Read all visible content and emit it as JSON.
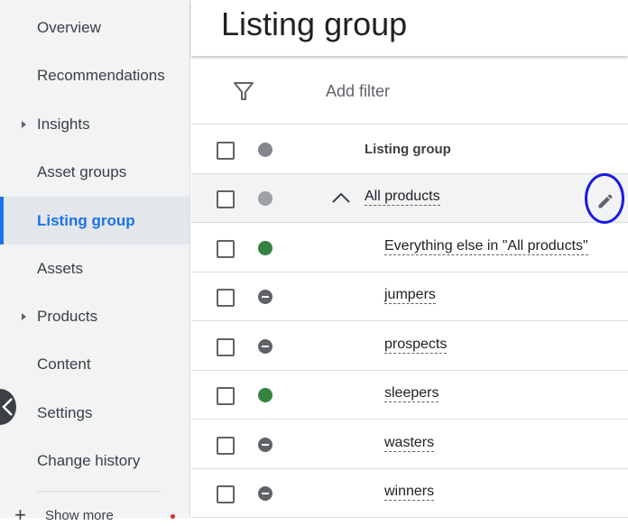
{
  "sidebar": {
    "items": [
      {
        "label": "Overview",
        "expandable": false
      },
      {
        "label": "Recommendations",
        "expandable": false
      },
      {
        "label": "Insights",
        "expandable": true
      },
      {
        "label": "Asset groups",
        "expandable": false
      },
      {
        "label": "Listing group",
        "expandable": false,
        "active": true
      },
      {
        "label": "Assets",
        "expandable": false
      },
      {
        "label": "Products",
        "expandable": true
      },
      {
        "label": "Content",
        "expandable": false
      },
      {
        "label": "Settings",
        "expandable": false
      },
      {
        "label": "Change history",
        "expandable": false
      }
    ],
    "show_more_label": "Show more"
  },
  "header": {
    "title": "Listing group"
  },
  "filter": {
    "add_filter_label": "Add filter"
  },
  "table": {
    "column_header": "Listing group",
    "root": {
      "label": "All products",
      "status": "gray"
    },
    "rows": [
      {
        "label": "Everything else in \"All products\"",
        "status": "included"
      },
      {
        "label": "jumpers",
        "status": "excluded"
      },
      {
        "label": "prospects",
        "status": "excluded"
      },
      {
        "label": "sleepers",
        "status": "included"
      },
      {
        "label": "wasters",
        "status": "excluded"
      },
      {
        "label": "winners",
        "status": "excluded"
      }
    ]
  },
  "colors": {
    "accent": "#1a73e8",
    "included": "#34843f",
    "excluded": "#5f6368",
    "annotation": "#1a1adc"
  },
  "icons": {
    "filter": "filter-funnel-icon",
    "edit": "pencil-icon",
    "expander": "chevron-up-icon",
    "collapse": "chevron-left-icon"
  }
}
